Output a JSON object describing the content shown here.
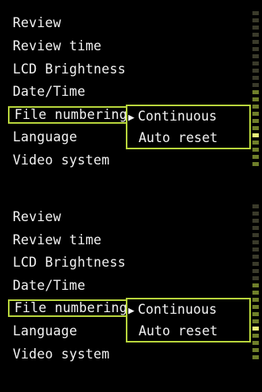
{
  "menus": [
    {
      "items": [
        {
          "label": "Review"
        },
        {
          "label": "Review time"
        },
        {
          "label": "LCD Brightness"
        },
        {
          "label": "Date/Time"
        },
        {
          "label": "File numbering"
        },
        {
          "label": "Language"
        },
        {
          "label": "Video system"
        }
      ],
      "submenu": {
        "selected": "Continuous",
        "other": "Auto reset"
      }
    },
    {
      "items": [
        {
          "label": "Review"
        },
        {
          "label": "Review time"
        },
        {
          "label": "LCD Brightness"
        },
        {
          "label": "Date/Time"
        },
        {
          "label": "File numbering"
        },
        {
          "label": "Language"
        },
        {
          "label": "Video system"
        }
      ],
      "submenu": {
        "selected": "Continuous",
        "other": "Auto reset"
      }
    }
  ],
  "colors": {
    "background": "#000000",
    "text": "#f2f2f2",
    "highlight_border": "#b8d53c",
    "scrollbar_dim": "#3a3a2a",
    "scrollbar_lit": "#6f7f2a",
    "scrollbar_on": "#e8f07a"
  },
  "icons": {
    "selection_arrow": "black-right-pointing-triangle"
  }
}
